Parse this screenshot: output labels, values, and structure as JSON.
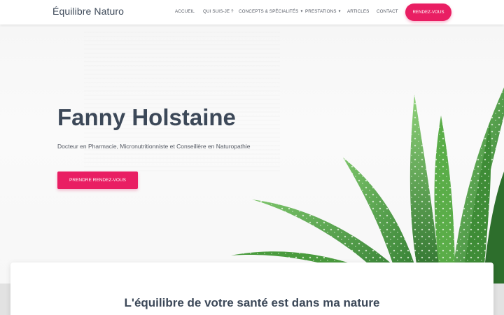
{
  "brand": "Équilibre Naturo",
  "nav": {
    "items": [
      {
        "label": "Accueil",
        "dropdown": false
      },
      {
        "label": "Qui suis-je ?",
        "dropdown": false
      },
      {
        "label": "Concepts & Spécialités",
        "dropdown": true
      },
      {
        "label": "Prestations",
        "dropdown": true
      },
      {
        "label": "Articles",
        "dropdown": false
      },
      {
        "label": "Contact",
        "dropdown": false
      }
    ],
    "cta_label": "Rendez-vous"
  },
  "hero": {
    "title": "Fanny Holstaine",
    "subtitle": "Docteur en Pharmacie, Micronutritionniste et Conseillère en Naturopathie",
    "cta_label": "Prendre rendez-vous"
  },
  "section": {
    "title": "L'équilibre de votre santé est dans ma nature"
  },
  "colors": {
    "accent": "#e91e63",
    "heading": "#3c4858",
    "text": "#555a64",
    "plant": "#3f8f3a"
  },
  "icons": {
    "dropdown": "caret-down-icon"
  }
}
